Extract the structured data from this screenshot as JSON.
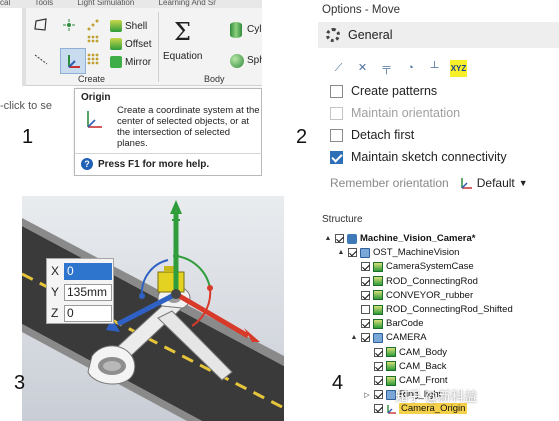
{
  "panel1": {
    "number": "1",
    "menubar": [
      "cal",
      "Tools",
      "Light Simulation",
      "Learning And Sr"
    ],
    "tools": {
      "shell": "Shell",
      "offset": "Offset",
      "mirror": "Mirror",
      "equation": "Equation",
      "cylinder": "Cylin",
      "sphere": "Sphe"
    },
    "groups": {
      "create": "Create",
      "body": "Body"
    },
    "click_hint": "-click to se",
    "tooltip": {
      "title": "Origin",
      "description": "Create a coordinate system at the center of selected objects, or at the intersection of selected planes.",
      "help": "Press F1 for more help."
    }
  },
  "panel2": {
    "number": "2",
    "title": "Options - Move",
    "section": "General",
    "toolbar_icons": [
      "move-along-trajectory-icon",
      "pivot-icon",
      "ruler-dimension-icon",
      "anchor-icon",
      "measure-icon",
      "xyz-icon"
    ],
    "xyz_label": "XYZ",
    "options": [
      {
        "label": "Create patterns",
        "checked": false,
        "enabled": true
      },
      {
        "label": "Maintain orientation",
        "checked": false,
        "enabled": false
      },
      {
        "label": "Detach first",
        "checked": false,
        "enabled": true
      },
      {
        "label": "Maintain sketch connectivity",
        "checked": true,
        "enabled": true
      }
    ],
    "remember_label": "Remember orientation",
    "remember_value": "Default"
  },
  "panel3": {
    "number": "3",
    "coords": [
      {
        "axis": "X",
        "value": "0",
        "selected": true
      },
      {
        "axis": "Y",
        "value": "135mm",
        "selected": false
      },
      {
        "axis": "Z",
        "value": "0",
        "selected": false
      }
    ]
  },
  "panel4": {
    "number": "4",
    "title": "Structure",
    "tree": [
      {
        "label": "Machine_Vision_Camera*",
        "icon": "root",
        "indent": 0,
        "twisty": "▲",
        "bold": true
      },
      {
        "label": "OST_MachineVision",
        "icon": "comp",
        "indent": 1,
        "twisty": "▲"
      },
      {
        "label": "CameraSystemCase",
        "icon": "solid",
        "indent": 2
      },
      {
        "label": "ROD_ConnectingRod",
        "icon": "solid",
        "indent": 2
      },
      {
        "label": "CONVEYOR_rubber",
        "icon": "solid",
        "indent": 2
      },
      {
        "label": "ROD_ConnectingRod_Shifted",
        "icon": "solid",
        "indent": 2,
        "unchecked": true
      },
      {
        "label": "BarCode",
        "icon": "solid",
        "indent": 2
      },
      {
        "label": "CAMERA",
        "icon": "comp",
        "indent": 2,
        "twisty": "▲"
      },
      {
        "label": "CAM_Body",
        "icon": "solid",
        "indent": 3
      },
      {
        "label": "CAM_Back",
        "icon": "solid",
        "indent": 3
      },
      {
        "label": "CAM_Front",
        "icon": "solid",
        "indent": 3
      },
      {
        "label": "Ring_light",
        "icon": "comp",
        "indent": 3,
        "twisty": "▷"
      },
      {
        "label": "Camera_Origin",
        "icon": "origin",
        "indent": 3,
        "highlight": true
      }
    ]
  },
  "watermark": "知乎 @新科益"
}
